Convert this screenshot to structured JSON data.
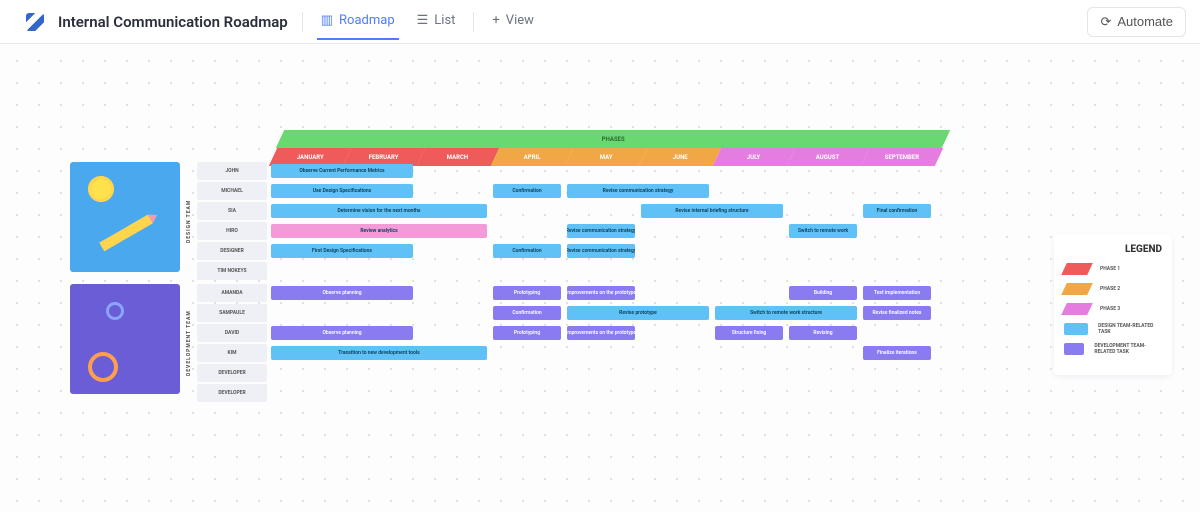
{
  "header": {
    "title": "Internal Communication Roadmap",
    "tabs": {
      "roadmap": "Roadmap",
      "list": "List",
      "view": "View"
    },
    "automate": "Automate"
  },
  "phases_band": "PHASES",
  "months": [
    "JANUARY",
    "FEBRUARY",
    "MARCH",
    "APRIL",
    "MAY",
    "JUNE",
    "JULY",
    "AUGUST",
    "SEPTEMBER"
  ],
  "month_phase": [
    1,
    1,
    1,
    2,
    2,
    2,
    3,
    3,
    3
  ],
  "sections": [
    {
      "team_label": "DESIGN TEAM",
      "thumb": "design",
      "members": [
        {
          "name": "JOHN",
          "tasks": [
            {
              "label": "Observe Current Performance Metrics",
              "start": 0,
              "span": 2,
              "color": "blue"
            }
          ]
        },
        {
          "name": "MICHAEL",
          "tasks": [
            {
              "label": "Use Design Specifications",
              "start": 0,
              "span": 2,
              "color": "blue"
            },
            {
              "label": "Confirmation",
              "start": 3,
              "span": 1,
              "color": "blue"
            },
            {
              "label": "Revise communication strategy",
              "start": 4,
              "span": 2,
              "color": "blue"
            }
          ]
        },
        {
          "name": "SIA",
          "tasks": [
            {
              "label": "Determine vision for the next months",
              "start": 0,
              "span": 3,
              "color": "blue"
            },
            {
              "label": "Revise internal briefing structure",
              "start": 5,
              "span": 2,
              "color": "blue"
            },
            {
              "label": "Final confirmation",
              "start": 8,
              "span": 1,
              "color": "blue"
            }
          ]
        },
        {
          "name": "HIRO",
          "tasks": [
            {
              "label": "Review analytics",
              "start": 0,
              "span": 3,
              "color": "pink"
            },
            {
              "label": "Revise communication strategy",
              "start": 4,
              "span": 1,
              "color": "blue"
            },
            {
              "label": "Switch to remote work",
              "start": 7,
              "span": 1,
              "color": "blue"
            }
          ]
        },
        {
          "name": "DESIGNER",
          "tasks": [
            {
              "label": "First Design Specifications",
              "start": 0,
              "span": 2,
              "color": "blue"
            },
            {
              "label": "Confirmation",
              "start": 3,
              "span": 1,
              "color": "blue"
            },
            {
              "label": "Revise communication strategy",
              "start": 4,
              "span": 1,
              "color": "blue"
            }
          ]
        },
        {
          "name": "TIM NOKEYS",
          "tasks": []
        }
      ]
    },
    {
      "team_label": "DEVELOPMENT TEAM",
      "thumb": "dev",
      "members": [
        {
          "name": "AMANDA",
          "tasks": [
            {
              "label": "Observe planning",
              "start": 0,
              "span": 2,
              "color": "purple"
            },
            {
              "label": "Prototyping",
              "start": 3,
              "span": 1,
              "color": "purple"
            },
            {
              "label": "Improvements on the prototype",
              "start": 4,
              "span": 1,
              "color": "purple"
            },
            {
              "label": "Building",
              "start": 7,
              "span": 1,
              "color": "purple"
            },
            {
              "label": "Test implementation",
              "start": 8,
              "span": 1,
              "color": "purple"
            }
          ]
        },
        {
          "name": "SAMPAULE",
          "tasks": [
            {
              "label": "Confirmation",
              "start": 3,
              "span": 1,
              "color": "purple"
            },
            {
              "label": "Revise prototype",
              "start": 4,
              "span": 2,
              "color": "blue"
            },
            {
              "label": "Switch to remote work structure",
              "start": 6,
              "span": 2,
              "color": "blue"
            },
            {
              "label": "Revise finalized notes",
              "start": 8,
              "span": 1,
              "color": "purple"
            }
          ]
        },
        {
          "name": "DAVID",
          "tasks": [
            {
              "label": "Observe planning",
              "start": 0,
              "span": 2,
              "color": "purple"
            },
            {
              "label": "Prototyping",
              "start": 3,
              "span": 1,
              "color": "purple"
            },
            {
              "label": "Improvements on the prototype",
              "start": 4,
              "span": 1,
              "color": "purple"
            },
            {
              "label": "Structure fixing",
              "start": 6,
              "span": 1,
              "color": "purple"
            },
            {
              "label": "Revising",
              "start": 7,
              "span": 1,
              "color": "purple"
            }
          ]
        },
        {
          "name": "KIM",
          "tasks": [
            {
              "label": "Transition to new development tools",
              "start": 0,
              "span": 3,
              "color": "blue"
            },
            {
              "label": "Finalize iterations",
              "start": 8,
              "span": 1,
              "color": "purple"
            }
          ]
        },
        {
          "name": "DEVELOPER",
          "tasks": []
        },
        {
          "name": "DEVELOPER",
          "tasks": []
        }
      ]
    }
  ],
  "legend": {
    "title": "LEGEND",
    "items": [
      {
        "label": "PHASE 1",
        "color": "#ef5a5a",
        "shape": "skew"
      },
      {
        "label": "PHASE 2",
        "color": "#f2a747",
        "shape": "skew"
      },
      {
        "label": "PHASE 3",
        "color": "#e57de0",
        "shape": "skew"
      },
      {
        "label": "DESIGN TEAM-RELATED TASK",
        "color": "#5fc1f5",
        "shape": "sq"
      },
      {
        "label": "DEVELOPMENT TEAM-RELATED TASK",
        "color": "#8a7cf0",
        "shape": "sq"
      }
    ]
  },
  "colors": {
    "blue": "#5fc1f5",
    "pink": "#f39ad8",
    "purple": "#8a7cf0"
  },
  "chart_data": {
    "type": "table",
    "title": "Internal Communication Roadmap",
    "x_categories": [
      "JANUARY",
      "FEBRUARY",
      "MARCH",
      "APRIL",
      "MAY",
      "JUNE",
      "JULY",
      "AUGUST",
      "SEPTEMBER"
    ],
    "phases": {
      "PHASE 1": [
        "JANUARY",
        "FEBRUARY",
        "MARCH"
      ],
      "PHASE 2": [
        "APRIL",
        "MAY",
        "JUNE"
      ],
      "PHASE 3": [
        "JULY",
        "AUGUST",
        "SEPTEMBER"
      ]
    }
  }
}
